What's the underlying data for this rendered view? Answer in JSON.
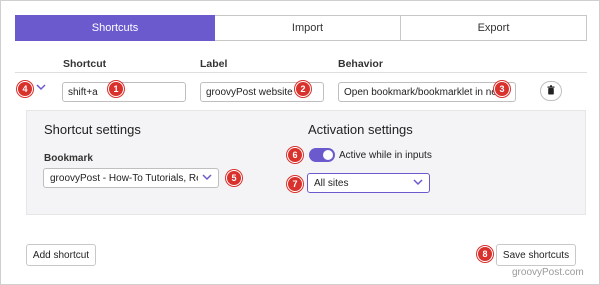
{
  "tabs": [
    {
      "label": "Shortcuts",
      "active": true
    },
    {
      "label": "Import",
      "active": false
    },
    {
      "label": "Export",
      "active": false
    }
  ],
  "columns": {
    "shortcut": "Shortcut",
    "label": "Label",
    "behavior": "Behavior"
  },
  "row": {
    "shortcut_value": "shift+a",
    "label_value": "groovyPost website",
    "behavior_value": "Open bookmark/bookmarklet in ne"
  },
  "panel": {
    "shortcut_settings_title": "Shortcut settings",
    "bookmark_label": "Bookmark",
    "bookmark_value": "groovyPost - How-To Tutorials, Rev",
    "activation_settings_title": "Activation settings",
    "active_in_inputs_label": "Active while in inputs",
    "active_in_inputs_on": true,
    "sites_value": "All sites"
  },
  "footer": {
    "add_shortcut": "Add shortcut",
    "save_shortcuts": "Save shortcuts"
  },
  "badges": [
    "1",
    "2",
    "3",
    "4",
    "5",
    "6",
    "7",
    "8"
  ],
  "watermark": "groovyPost.com",
  "colors": {
    "accent": "#6a5acd",
    "badge": "#d9312c"
  },
  "icons": {
    "expand": "chevron-down-icon",
    "delete": "trash-icon",
    "dropdown": "chevron-down-icon"
  }
}
